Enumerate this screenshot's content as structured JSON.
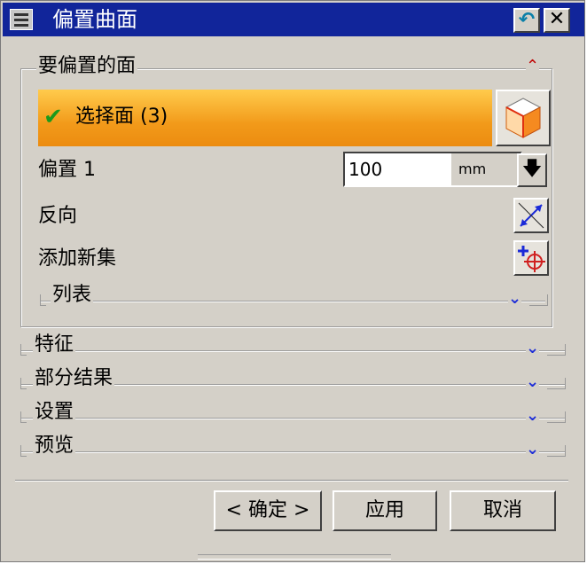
{
  "window": {
    "title": "偏置曲面"
  },
  "group": {
    "label": "要偏置的面",
    "select_label": "选择面 (3)",
    "offset_label": "偏置 1",
    "offset_value": "100",
    "offset_unit": "mm",
    "reverse_label": "反向",
    "add_set_label": "添加新集",
    "list_label": "列表"
  },
  "sections": [
    {
      "label": "特征"
    },
    {
      "label": "部分结果"
    },
    {
      "label": "设置"
    },
    {
      "label": "预览"
    }
  ],
  "buttons": {
    "ok": "< 确定 >",
    "apply": "应用",
    "cancel": "取消"
  },
  "colors": {
    "titlebar": "#11259a",
    "selection_highlight": "#f29a1a",
    "expand_chevron": "#1a2ad8",
    "collapse_chevron": "#c00000"
  }
}
